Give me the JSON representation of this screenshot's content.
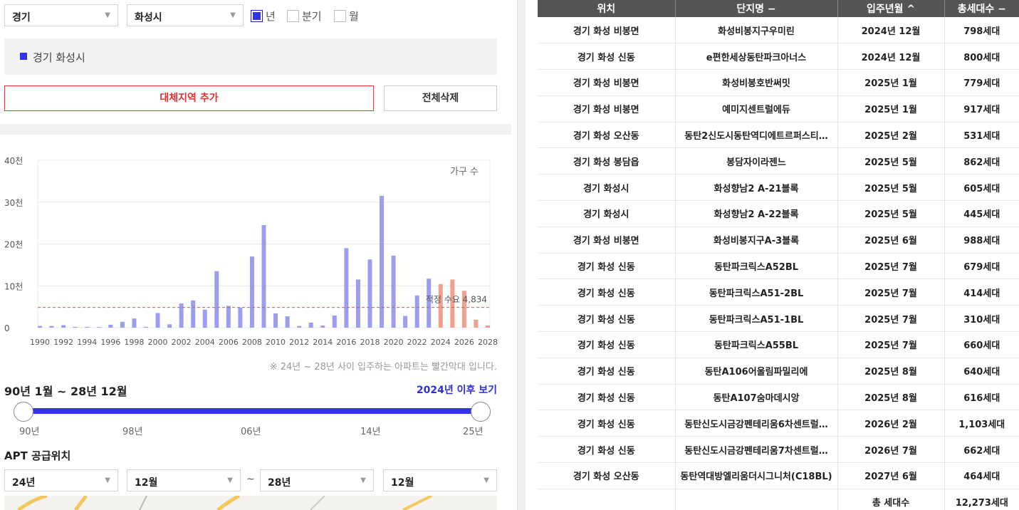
{
  "filters": {
    "province": "경기",
    "city": "화성시",
    "periods": [
      {
        "label": "년",
        "checked": true
      },
      {
        "label": "분기",
        "checked": false
      },
      {
        "label": "월",
        "checked": false
      }
    ]
  },
  "region_list": [
    "경기 화성시"
  ],
  "buttons": {
    "add_region": "대체지역 추가",
    "delete_all": "전체삭제"
  },
  "chart_data": {
    "type": "bar",
    "legend_label": "가구 수",
    "x": [
      1990,
      1991,
      1992,
      1993,
      1994,
      1995,
      1996,
      1997,
      1998,
      1999,
      2000,
      2001,
      2002,
      2003,
      2004,
      2005,
      2006,
      2007,
      2008,
      2009,
      2010,
      2011,
      2012,
      2013,
      2014,
      2015,
      2016,
      2017,
      2018,
      2019,
      2020,
      2021,
      2022,
      2023,
      2024,
      2025,
      2026,
      2027,
      2028
    ],
    "values": [
      400,
      400,
      600,
      200,
      200,
      150,
      700,
      1400,
      2200,
      200,
      3500,
      800,
      5800,
      6500,
      4300,
      13500,
      5200,
      4800,
      17000,
      24500,
      3400,
      2700,
      400,
      1200,
      500,
      2900,
      19000,
      11500,
      16300,
      31500,
      17200,
      2800,
      7700,
      11700,
      10400,
      11500,
      8800,
      1900,
      500
    ],
    "highlight_from": 2024,
    "x_ticks": [
      1990,
      1992,
      1994,
      1996,
      1998,
      2000,
      2002,
      2004,
      2006,
      2008,
      2010,
      2012,
      2014,
      2016,
      2018,
      2020,
      2022,
      2024,
      2026,
      2028
    ],
    "y_ticks": [
      0,
      10000,
      20000,
      30000,
      40000
    ],
    "y_tick_labels": [
      "0",
      "10천",
      "20천",
      "30천",
      "40천"
    ],
    "ylim": [
      0,
      40000
    ],
    "reference_line": {
      "value": 4834,
      "label": "적정 수요 4,834"
    },
    "colors": {
      "normal": "#9c9cf0",
      "highlight": "#f0a090",
      "reference": "#e05050"
    }
  },
  "chart_note": "※ 24년 ~ 28년 사이 입주하는 아파트는 빨간막대 입니다.",
  "range": {
    "title": "90년 1월 ~ 28년 12월",
    "link": "2024년 이후 보기",
    "ticks": [
      "90년",
      "98년",
      "06년",
      "14년",
      "25년"
    ]
  },
  "apt_supply": {
    "title": "APT 공급위치",
    "from_year": "24년",
    "from_month": "12월",
    "to_year": "28년",
    "to_month": "12월",
    "tilde": "~"
  },
  "table": {
    "headers": [
      "위치",
      "단지명 −",
      "입주년월 ^",
      "총세대수 −"
    ],
    "rows": [
      [
        "경기 화성 비봉면",
        "화성비봉지구우미린",
        "2024년 12월",
        "798세대"
      ],
      [
        "경기 화성 신동",
        "e편한세상동탄파크아너스",
        "2024년 12월",
        "800세대"
      ],
      [
        "경기 화성 비봉면",
        "화성비봉호반써밋",
        "2025년 1월",
        "779세대"
      ],
      [
        "경기 화성 비봉면",
        "예미지센트럴에듀",
        "2025년 1월",
        "917세대"
      ],
      [
        "경기 화성 오산동",
        "동탄2신도시동탄역디에트르퍼스티…",
        "2025년 2월",
        "531세대"
      ],
      [
        "경기 화성 봉담읍",
        "봉담자이라젠느",
        "2025년 5월",
        "862세대"
      ],
      [
        "경기 화성시",
        "화성향남2 A-21블록",
        "2025년 5월",
        "605세대"
      ],
      [
        "경기 화성시",
        "화성향남2 A-22블록",
        "2025년 5월",
        "445세대"
      ],
      [
        "경기 화성 비봉면",
        "화성비봉지구A-3블록",
        "2025년 6월",
        "988세대"
      ],
      [
        "경기 화성 신동",
        "동탄파크릭스A52BL",
        "2025년 7월",
        "679세대"
      ],
      [
        "경기 화성 신동",
        "동탄파크릭스A51-2BL",
        "2025년 7월",
        "414세대"
      ],
      [
        "경기 화성 신동",
        "동탄파크릭스A51-1BL",
        "2025년 7월",
        "310세대"
      ],
      [
        "경기 화성 신동",
        "동탄파크릭스A55BL",
        "2025년 7월",
        "660세대"
      ],
      [
        "경기 화성 신동",
        "동탄A106어울림파밀리에",
        "2025년 8월",
        "640세대"
      ],
      [
        "경기 화성 신동",
        "동탄A107숨마데시앙",
        "2025년 8월",
        "616세대"
      ],
      [
        "경기 화성 신동",
        "동탄신도시금강펜테리움6차센트럴…",
        "2026년 2월",
        "1,103세대"
      ],
      [
        "경기 화성 신동",
        "동탄신도시금강펜테리움7차센트럴…",
        "2026년 7월",
        "662세대"
      ],
      [
        "경기 화성 오산동",
        "동탄역대방엘리움더시그니처(C18BL)",
        "2027년 6월",
        "464세대"
      ]
    ],
    "total_label": "총 세대수",
    "total_value": "12,273세대"
  }
}
